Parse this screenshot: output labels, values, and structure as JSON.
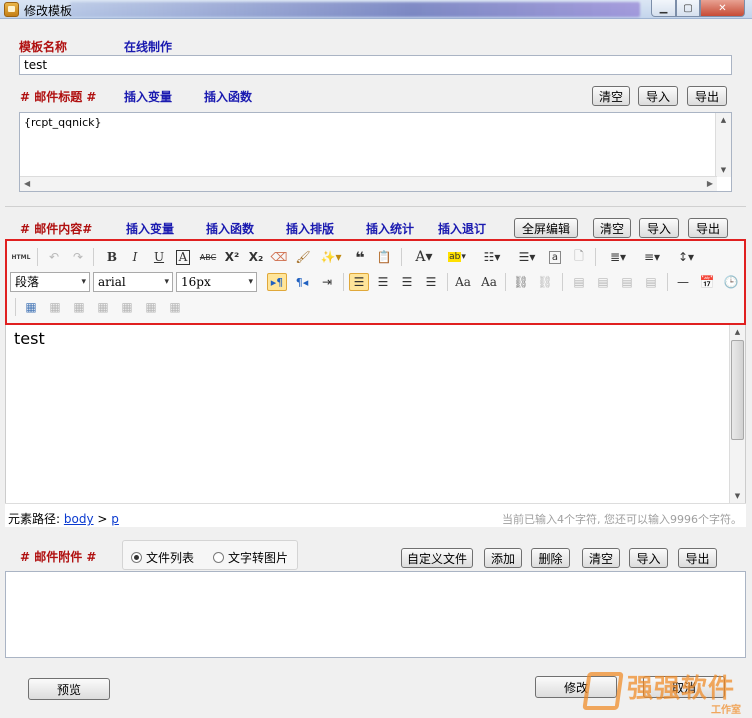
{
  "window": {
    "title": "修改模板"
  },
  "template_name": {
    "label": "模板名称",
    "online_link": "在线制作",
    "value": "test"
  },
  "subject": {
    "label": "# 邮件标题 #",
    "insert_var": "插入变量",
    "insert_func": "插入函数",
    "value": "{rcpt_qqnick}",
    "clear": "清空",
    "import": "导入",
    "export": "导出"
  },
  "content": {
    "label": "# 邮件内容#",
    "insert_var": "插入变量",
    "insert_func": "插入函数",
    "insert_layout": "插入排版",
    "insert_stat": "插入统计",
    "insert_unsub": "插入退订",
    "fullscreen": "全屏编辑",
    "clear": "清空",
    "import": "导入",
    "export": "导出"
  },
  "toolbar": {
    "html_label": "HTML",
    "paragraph": "段落",
    "font": "arial",
    "size": "16px"
  },
  "editor": {
    "text": "test"
  },
  "status": {
    "path_label": "元素路径:",
    "path_body": "body",
    "path_sep": ">",
    "path_p": "p",
    "char_count": "当前已输入4个字符, 您还可以输入9996个字符。"
  },
  "attachment": {
    "label": "# 邮件附件 #",
    "opt_list": "文件列表",
    "opt_text_img": "文字转图片",
    "custom_file": "自定义文件",
    "add": "添加",
    "delete": "删除",
    "clear": "清空",
    "import": "导入",
    "export": "导出"
  },
  "footer": {
    "preview": "预览",
    "modify": "修改",
    "cancel": "取消"
  },
  "watermark": {
    "text": "强强软件",
    "sub": "工作室"
  }
}
